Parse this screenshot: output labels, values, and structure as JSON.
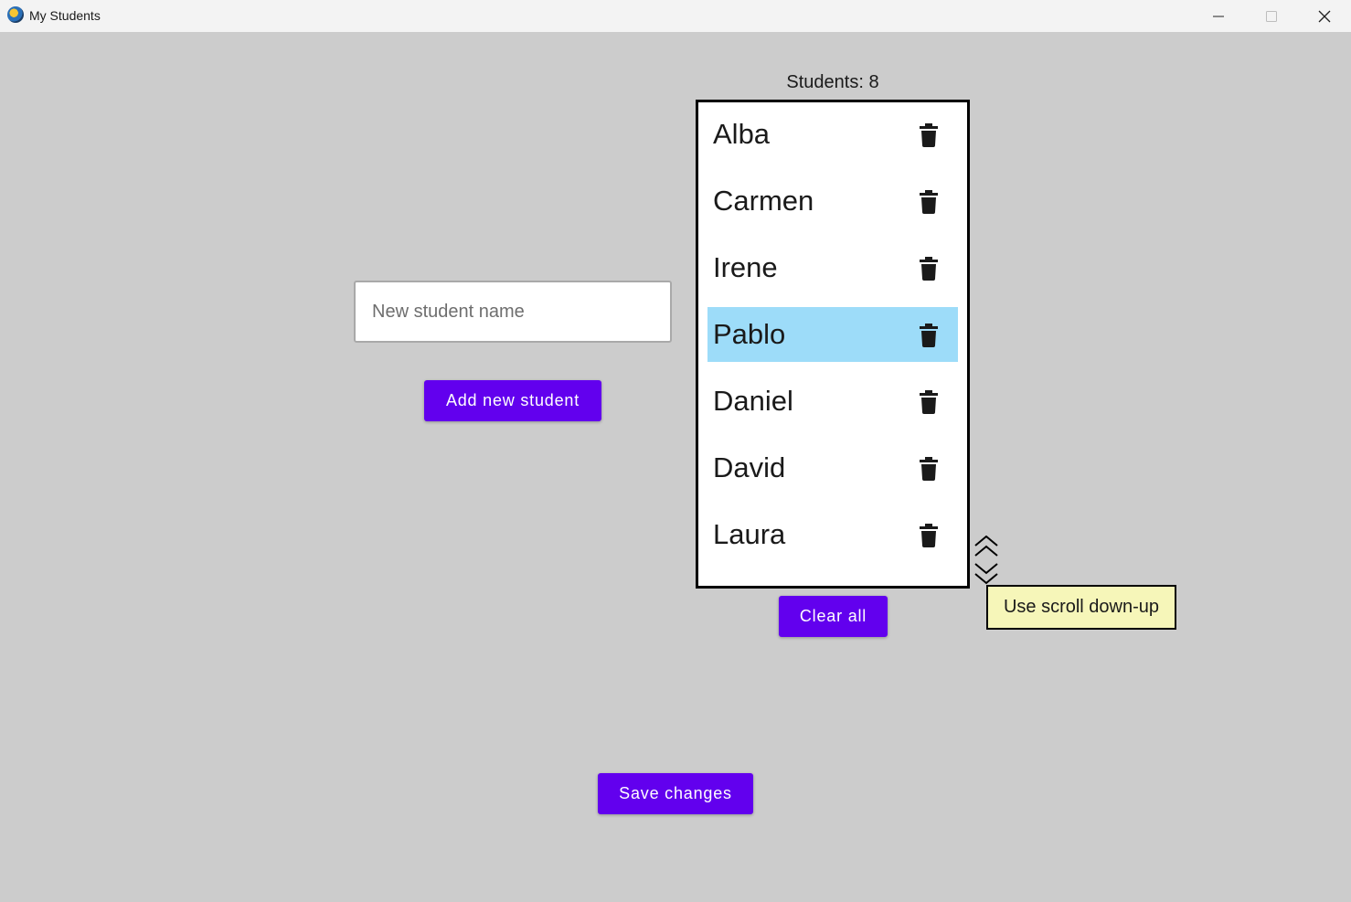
{
  "window": {
    "title": "My Students",
    "controls": {
      "minimize": "minimize-icon",
      "maximize": "maximize-icon",
      "close": "close-icon"
    }
  },
  "form": {
    "input_placeholder": "New student name",
    "input_value": "",
    "add_button_label": "Add new student"
  },
  "students": {
    "count_label": "Students: 8",
    "items": [
      {
        "name": "Alba",
        "selected": false
      },
      {
        "name": "Carmen",
        "selected": false
      },
      {
        "name": "Irene",
        "selected": false
      },
      {
        "name": "Pablo",
        "selected": true
      },
      {
        "name": "Daniel",
        "selected": false
      },
      {
        "name": "David",
        "selected": false
      },
      {
        "name": "Laura",
        "selected": false
      }
    ],
    "delete_icon": "trash-icon",
    "clear_button_label": "Clear all",
    "selected_color": "#9ddcf9"
  },
  "scroll_hint": {
    "icon": "scroll-arrows-icon",
    "tooltip": "Use scroll down-up"
  },
  "footer": {
    "save_button_label": "Save changes"
  },
  "colors": {
    "accent": "#6200ee",
    "background": "#cccccc",
    "tooltip_bg": "#f6f6b9"
  }
}
